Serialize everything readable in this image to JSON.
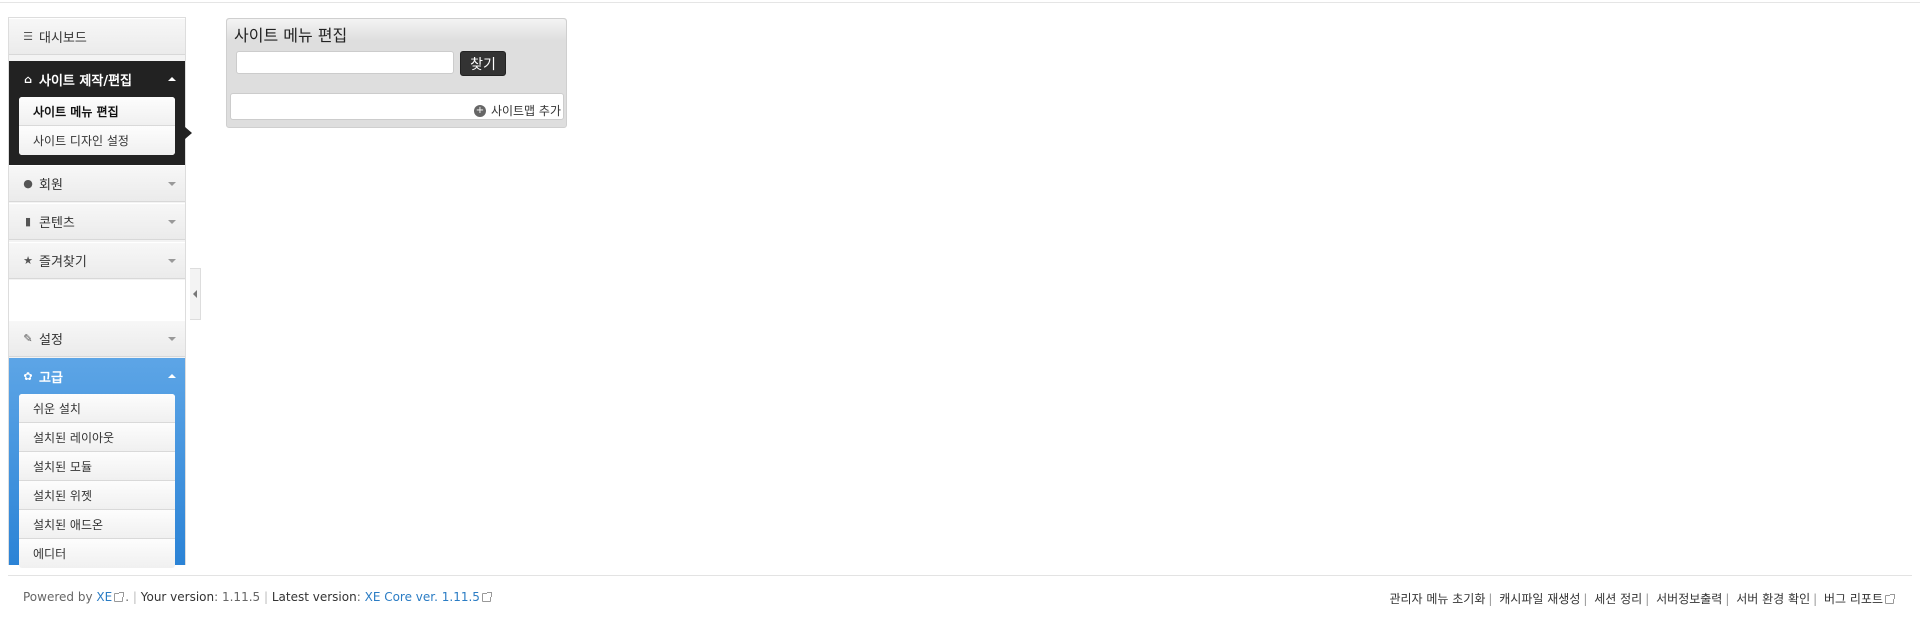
{
  "sidebar": {
    "dashboard": {
      "label": "대시보드",
      "icon": "list-icon"
    },
    "site": {
      "label": "사이트 제작/편집",
      "icon": "home-icon",
      "items": [
        {
          "label": "사이트 메뉴 편집",
          "active": true
        },
        {
          "label": "사이트 디자인 설정",
          "active": false
        }
      ]
    },
    "member": {
      "label": "회원",
      "icon": "user-icon"
    },
    "content": {
      "label": "콘텐츠",
      "icon": "book-icon"
    },
    "favorites": {
      "label": "즐겨찾기",
      "icon": "star-icon"
    },
    "settings": {
      "label": "설정",
      "icon": "wrench-icon"
    },
    "advanced": {
      "label": "고급",
      "icon": "cog-icon",
      "items": [
        {
          "label": "쉬운 설치"
        },
        {
          "label": "설치된 레이아웃"
        },
        {
          "label": "설치된 모듈"
        },
        {
          "label": "설치된 위젯"
        },
        {
          "label": "설치된 애드온"
        },
        {
          "label": "에디터"
        }
      ]
    }
  },
  "panel": {
    "title": "사이트 메뉴 편집",
    "search_value": "",
    "search_button": "찾기",
    "add_sitemap": "사이트맵 추가"
  },
  "footer": {
    "powered_by": "Powered by",
    "xe_link": "XE",
    "after_xe": ".",
    "your_version_label": "Your version",
    "your_version": ": 1.11.5",
    "latest_version_label": "Latest version",
    "latest_colon": ":",
    "latest_link": "XE Core ver. 1.11.5",
    "links": [
      "관리자 메뉴 초기화",
      "캐시파일 재생성",
      "세션 정리",
      "서버정보출력",
      "서버 환경 확인",
      "버그 리포트"
    ]
  },
  "colors": {
    "active_group": "#222222",
    "advanced_group": "#2b83d6",
    "link": "#2a7cc4",
    "button": "#333333"
  }
}
